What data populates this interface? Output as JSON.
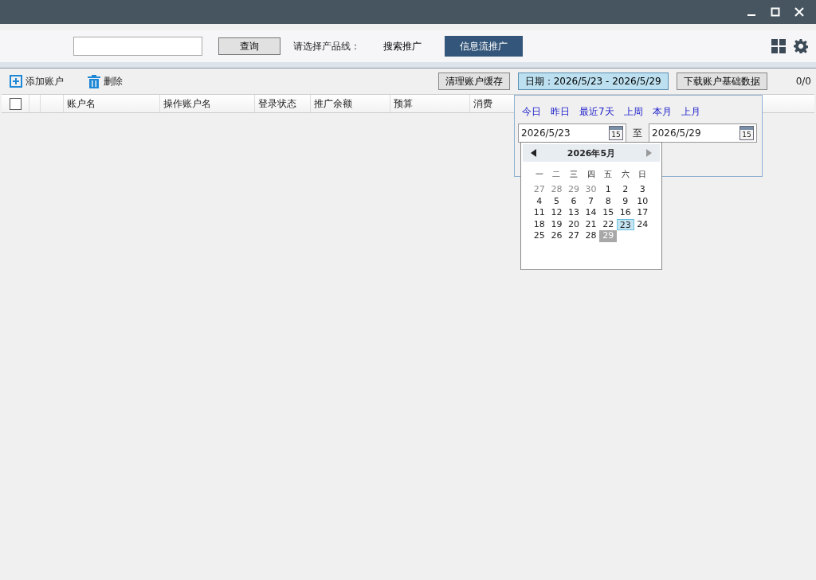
{
  "search_bar": {
    "query_button": "查询",
    "product_line_label": "请选择产品线：",
    "product_tabs": [
      {
        "label": "搜索推广",
        "selected": false
      },
      {
        "label": "信息流推广",
        "selected": true
      }
    ]
  },
  "toolbar": {
    "add_account": "添加账户",
    "delete": "删除",
    "clear_cache": "清理账户缓存",
    "date_button": "日期：2026/5/23 - 2026/5/29",
    "download": "下载账户基础数据",
    "count": "0/0"
  },
  "table": {
    "columns": [
      "账户名",
      "操作账户名",
      "登录状态",
      "推广余额",
      "预算",
      "消费"
    ],
    "select_all_checked": false
  },
  "date_panel": {
    "shortcuts": [
      "今日",
      "昨日",
      "最近7天",
      "上周",
      "本月",
      "上月"
    ],
    "start": "2026/5/23",
    "start_icon_day": "15",
    "separator": "至",
    "end": "2026/5/29",
    "end_icon_day": "15",
    "calendar": {
      "title": "2026年5月",
      "weekdays": [
        "一",
        "二",
        "三",
        "四",
        "五",
        "六",
        "日"
      ],
      "days": [
        {
          "day": "27",
          "muted": true,
          "selected": false,
          "today": false
        },
        {
          "day": "28",
          "muted": true,
          "selected": false,
          "today": false
        },
        {
          "day": "29",
          "muted": true,
          "selected": false,
          "today": false
        },
        {
          "day": "30",
          "muted": true,
          "selected": false,
          "today": false
        },
        {
          "day": "1",
          "muted": false,
          "selected": false,
          "today": false
        },
        {
          "day": "2",
          "muted": false,
          "selected": false,
          "today": false
        },
        {
          "day": "3",
          "muted": false,
          "selected": false,
          "today": false
        },
        {
          "day": "4",
          "muted": false,
          "selected": false,
          "today": false
        },
        {
          "day": "5",
          "muted": false,
          "selected": false,
          "today": false
        },
        {
          "day": "6",
          "muted": false,
          "selected": false,
          "today": false
        },
        {
          "day": "7",
          "muted": false,
          "selected": false,
          "today": false
        },
        {
          "day": "8",
          "muted": false,
          "selected": false,
          "today": false
        },
        {
          "day": "9",
          "muted": false,
          "selected": false,
          "today": false
        },
        {
          "day": "10",
          "muted": false,
          "selected": false,
          "today": false
        },
        {
          "day": "11",
          "muted": false,
          "selected": false,
          "today": false
        },
        {
          "day": "12",
          "muted": false,
          "selected": false,
          "today": false
        },
        {
          "day": "13",
          "muted": false,
          "selected": false,
          "today": false
        },
        {
          "day": "14",
          "muted": false,
          "selected": false,
          "today": false
        },
        {
          "day": "15",
          "muted": false,
          "selected": false,
          "today": false
        },
        {
          "day": "16",
          "muted": false,
          "selected": false,
          "today": false
        },
        {
          "day": "17",
          "muted": false,
          "selected": false,
          "today": false
        },
        {
          "day": "18",
          "muted": false,
          "selected": false,
          "today": false
        },
        {
          "day": "19",
          "muted": false,
          "selected": false,
          "today": false
        },
        {
          "day": "20",
          "muted": false,
          "selected": false,
          "today": false
        },
        {
          "day": "21",
          "muted": false,
          "selected": false,
          "today": false
        },
        {
          "day": "22",
          "muted": false,
          "selected": false,
          "today": false
        },
        {
          "day": "23",
          "muted": false,
          "selected": true,
          "today": false
        },
        {
          "day": "24",
          "muted": false,
          "selected": false,
          "today": false
        },
        {
          "day": "25",
          "muted": false,
          "selected": false,
          "today": false
        },
        {
          "day": "26",
          "muted": false,
          "selected": false,
          "today": false
        },
        {
          "day": "27",
          "muted": false,
          "selected": false,
          "today": false
        },
        {
          "day": "28",
          "muted": false,
          "selected": false,
          "today": false
        },
        {
          "day": "29",
          "muted": false,
          "selected": false,
          "today": true
        }
      ]
    }
  }
}
